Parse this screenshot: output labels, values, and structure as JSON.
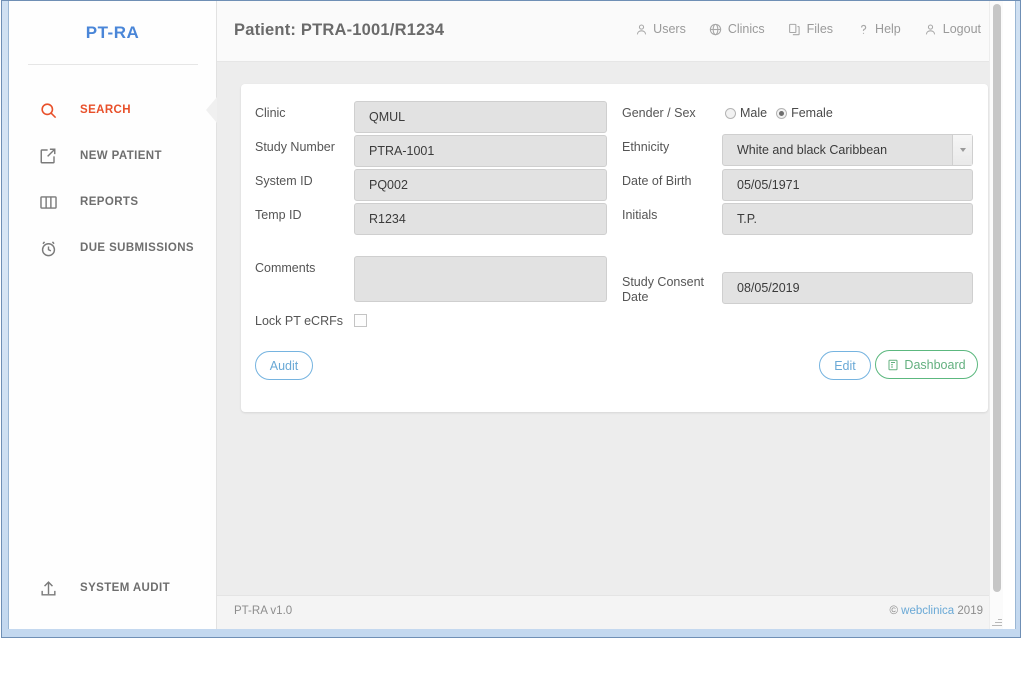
{
  "brand": {
    "name": "PT-RA"
  },
  "sidebar": {
    "items": [
      {
        "label": "SEARCH",
        "icon": "search-icon",
        "active": true
      },
      {
        "label": "NEW PATIENT",
        "icon": "new-patient-icon",
        "active": false
      },
      {
        "label": "REPORTS",
        "icon": "reports-icon",
        "active": false
      },
      {
        "label": "DUE SUBMISSIONS",
        "icon": "clock-icon",
        "active": false
      }
    ],
    "bottom": {
      "label": "SYSTEM AUDIT",
      "icon": "upload-icon"
    }
  },
  "header": {
    "title": "Patient: PTRA-1001/R1234",
    "nav": [
      {
        "label": "Users",
        "icon": "user-icon"
      },
      {
        "label": "Clinics",
        "icon": "globe-icon"
      },
      {
        "label": "Files",
        "icon": "files-icon"
      },
      {
        "label": "Help",
        "icon": "question-icon"
      },
      {
        "label": "Logout",
        "icon": "user-icon"
      }
    ]
  },
  "form": {
    "left": {
      "clinic_label": "Clinic",
      "clinic_value": "QMUL",
      "study_number_label": "Study Number",
      "study_number_value": "PTRA-1001",
      "system_id_label": "System ID",
      "system_id_value": "PQ002",
      "temp_id_label": "Temp ID",
      "temp_id_value": "R1234",
      "comments_label": "Comments",
      "comments_value": "",
      "lock_label": "Lock PT eCRFs",
      "lock_checked": false
    },
    "right": {
      "gender_label": "Gender / Sex",
      "gender_options": [
        {
          "label": "Male",
          "selected": false
        },
        {
          "label": "Female",
          "selected": true
        }
      ],
      "ethnicity_label": "Ethnicity",
      "ethnicity_value": "White and black Caribbean",
      "dob_label": "Date of Birth",
      "dob_value": "05/05/1971",
      "initials_label": "Initials",
      "initials_value": "T.P.",
      "consent_label": "Study Consent Date",
      "consent_value": "08/05/2019"
    }
  },
  "actions": {
    "audit": "Audit",
    "edit": "Edit",
    "dashboard": "Dashboard"
  },
  "footer": {
    "version": "PT-RA v1.0",
    "copyright_mark": "©",
    "brand": "webclinica",
    "year": "2019"
  },
  "colors": {
    "accent_orange": "#e8502a",
    "brand_blue": "#4a86d8",
    "button_blue": "#6aa9d6",
    "button_green": "#63b07f",
    "content_bg": "#ededed",
    "input_bg": "#e2e2e2"
  }
}
